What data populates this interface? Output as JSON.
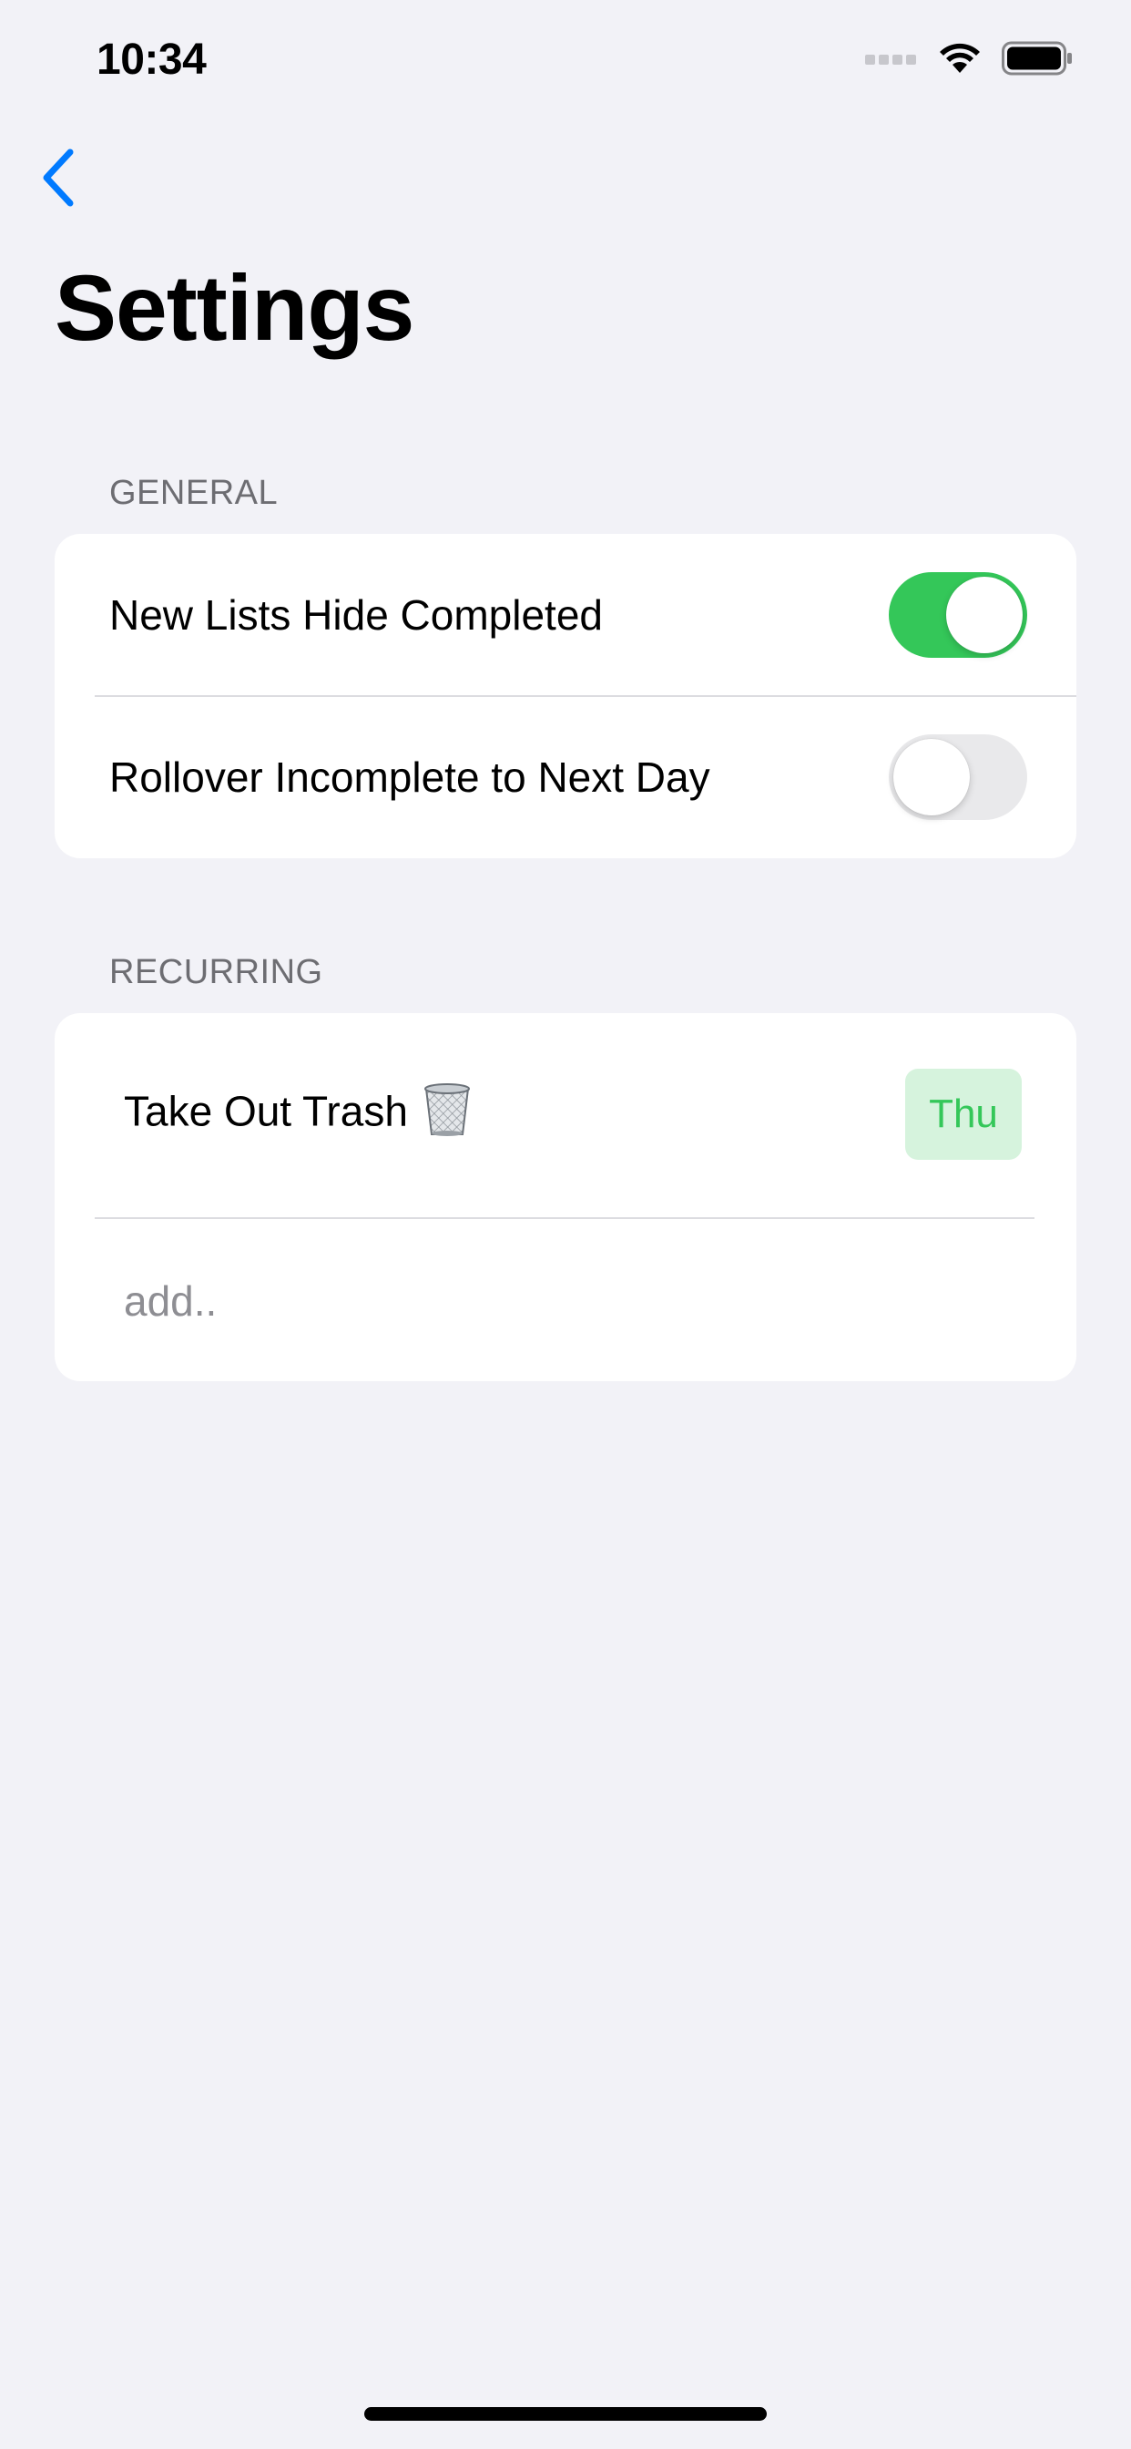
{
  "status_bar": {
    "time": "10:34",
    "icons": [
      "cellular-signal-icon",
      "wifi-icon",
      "battery-icon"
    ]
  },
  "nav": {
    "back_icon": "chevron-left-icon",
    "title": "Settings"
  },
  "general": {
    "header": "GENERAL",
    "rows": [
      {
        "label": "New Lists Hide Completed",
        "toggle_on": true
      },
      {
        "label": "Rollover Incomplete to Next Day",
        "toggle_on": false
      }
    ]
  },
  "recurring": {
    "header": "RECURRING",
    "items": [
      {
        "label": "Take Out Trash",
        "icon": "wastebasket-icon",
        "day": "Thu"
      }
    ],
    "add_placeholder": "add.."
  },
  "colors": {
    "accent_blue": "#007aff",
    "toggle_on_green": "#34c759",
    "day_badge_bg": "#d6f3dd",
    "background": "#f2f2f7"
  }
}
